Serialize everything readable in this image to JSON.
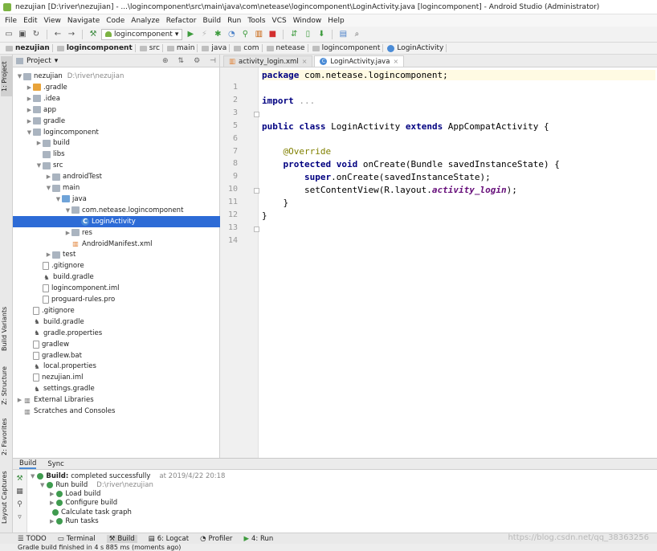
{
  "title": "nezujian [D:\\river\\nezujian] - ...\\logincomponent\\src\\main\\java\\com\\netease\\logincomponent\\LoginActivity.java [logincomponent] - Android Studio (Administrator)",
  "menu": [
    "File",
    "Edit",
    "View",
    "Navigate",
    "Code",
    "Analyze",
    "Refactor",
    "Build",
    "Run",
    "Tools",
    "VCS",
    "Window",
    "Help"
  ],
  "toolbar": {
    "run_config": "logincomponent",
    "icons": [
      "open-icon",
      "save-icon",
      "sync-icon",
      "back-icon",
      "forward-icon",
      "hammer-icon",
      "run-icon",
      "debug-icon",
      "bug-icon",
      "profile-icon",
      "apply-changes-icon",
      "stop-icon",
      "sdk-manager-icon",
      "avd-icon",
      "device-icon"
    ]
  },
  "breadcrumbs": [
    "nezujian",
    "logincomponent",
    "src",
    "main",
    "java",
    "com",
    "netease",
    "logincomponent",
    "LoginActivity"
  ],
  "left_strip": {
    "project": "1: Project",
    "build_variants": "Build Variants",
    "structure": "Z: Structure",
    "favorites": "2: Favorites",
    "layout_captures": "Layout Captures"
  },
  "project_panel": {
    "title": "Project",
    "tree": [
      {
        "label": "nezujian",
        "path": "D:\\river\\nezujian",
        "depth": 0,
        "arrow": "open",
        "icon": "folder"
      },
      {
        "label": ".gradle",
        "depth": 1,
        "arrow": "closed",
        "icon": "folder-orange"
      },
      {
        "label": ".idea",
        "depth": 1,
        "arrow": "closed",
        "icon": "folder"
      },
      {
        "label": "app",
        "depth": 1,
        "arrow": "closed",
        "icon": "folder"
      },
      {
        "label": "gradle",
        "depth": 1,
        "arrow": "closed",
        "icon": "folder"
      },
      {
        "label": "logincomponent",
        "depth": 1,
        "arrow": "open",
        "icon": "folder"
      },
      {
        "label": "build",
        "depth": 2,
        "arrow": "closed",
        "icon": "folder"
      },
      {
        "label": "libs",
        "depth": 2,
        "arrow": "",
        "icon": "folder"
      },
      {
        "label": "src",
        "depth": 2,
        "arrow": "open",
        "icon": "folder"
      },
      {
        "label": "androidTest",
        "depth": 3,
        "arrow": "closed",
        "icon": "folder"
      },
      {
        "label": "main",
        "depth": 3,
        "arrow": "open",
        "icon": "folder"
      },
      {
        "label": "java",
        "depth": 4,
        "arrow": "open",
        "icon": "folder-blue"
      },
      {
        "label": "com.netease.logincomponent",
        "depth": 5,
        "arrow": "open",
        "icon": "folder"
      },
      {
        "label": "LoginActivity",
        "depth": 6,
        "arrow": "",
        "icon": "class",
        "selected": true
      },
      {
        "label": "res",
        "depth": 5,
        "arrow": "closed",
        "icon": "folder"
      },
      {
        "label": "AndroidManifest.xml",
        "depth": 5,
        "arrow": "",
        "icon": "xml"
      },
      {
        "label": "test",
        "depth": 3,
        "arrow": "closed",
        "icon": "folder"
      },
      {
        "label": ".gitignore",
        "depth": 2,
        "arrow": "",
        "icon": "file"
      },
      {
        "label": "build.gradle",
        "depth": 2,
        "arrow": "",
        "icon": "gradle"
      },
      {
        "label": "logincomponent.iml",
        "depth": 2,
        "arrow": "",
        "icon": "file"
      },
      {
        "label": "proguard-rules.pro",
        "depth": 2,
        "arrow": "",
        "icon": "file"
      },
      {
        "label": ".gitignore",
        "depth": 1,
        "arrow": "",
        "icon": "file"
      },
      {
        "label": "build.gradle",
        "depth": 1,
        "arrow": "",
        "icon": "gradle"
      },
      {
        "label": "gradle.properties",
        "depth": 1,
        "arrow": "",
        "icon": "gradle"
      },
      {
        "label": "gradlew",
        "depth": 1,
        "arrow": "",
        "icon": "file"
      },
      {
        "label": "gradlew.bat",
        "depth": 1,
        "arrow": "",
        "icon": "file"
      },
      {
        "label": "local.properties",
        "depth": 1,
        "arrow": "",
        "icon": "gradle"
      },
      {
        "label": "nezujian.iml",
        "depth": 1,
        "arrow": "",
        "icon": "file"
      },
      {
        "label": "settings.gradle",
        "depth": 1,
        "arrow": "",
        "icon": "gradle"
      },
      {
        "label": "External Libraries",
        "depth": 0,
        "arrow": "closed",
        "icon": "lib"
      },
      {
        "label": "Scratches and Consoles",
        "depth": 0,
        "arrow": "",
        "icon": "lib"
      }
    ]
  },
  "editor": {
    "tabs": [
      {
        "label": "activity_login.xml",
        "active": false
      },
      {
        "label": "LoginActivity.java",
        "active": true
      }
    ],
    "lines": [
      {
        "no": "1",
        "html": "<span class=\"kw\">package</span> com.netease.logincomponent;",
        "current": true
      },
      {
        "no": "2",
        "html": ""
      },
      {
        "no": "3",
        "html": "<span class=\"kw\">import</span> <span class=\"fold\">...</span>"
      },
      {
        "no": "5",
        "html": ""
      },
      {
        "no": "6",
        "html": "<span class=\"kw\">public class</span> LoginActivity <span class=\"kw\">extends</span> AppCompatActivity {"
      },
      {
        "no": "7",
        "html": ""
      },
      {
        "no": "8",
        "html": "    <span class=\"ann\">@Override</span>"
      },
      {
        "no": "9",
        "html": "    <span class=\"kw\">protected void</span> onCreate(Bundle savedInstanceState) {"
      },
      {
        "no": "10",
        "html": "        <span class=\"kw\">super</span>.onCreate(savedInstanceState);"
      },
      {
        "no": "11",
        "html": "        setContentView(R.layout.<span class=\"it\">activity_login</span>);"
      },
      {
        "no": "12",
        "html": "    }"
      },
      {
        "no": "13",
        "html": "}"
      },
      {
        "no": "14",
        "html": ""
      }
    ]
  },
  "build_panel": {
    "tabs": [
      {
        "label": "Build",
        "active": true
      },
      {
        "label": "Sync",
        "active": false
      }
    ],
    "rows": [
      {
        "label": "Build:",
        "label2": "completed successfully",
        "meta": "at 2019/4/22 20:18",
        "depth": 0,
        "arrow": "open"
      },
      {
        "label": "Run build",
        "meta": "D:\\river\\nezujian",
        "depth": 1,
        "arrow": "open"
      },
      {
        "label": "Load build",
        "depth": 2,
        "arrow": "closed"
      },
      {
        "label": "Configure build",
        "depth": 2,
        "arrow": "closed"
      },
      {
        "label": "Calculate task graph",
        "depth": 2,
        "arrow": ""
      },
      {
        "label": "Run tasks",
        "depth": 2,
        "arrow": "closed"
      }
    ]
  },
  "bottom_tabs": [
    {
      "label": "TODO",
      "icon": "list-icon",
      "active": false
    },
    {
      "label": "Terminal",
      "icon": "terminal-icon",
      "active": false
    },
    {
      "label": "Build",
      "icon": "hammer-icon",
      "active": true
    },
    {
      "label": "6: Logcat",
      "icon": "logcat-icon",
      "active": false
    },
    {
      "label": "Profiler",
      "icon": "profiler-icon",
      "active": false
    },
    {
      "label": "4: Run",
      "icon": "run-icon",
      "active": false
    }
  ],
  "watermark": "https://blog.csdn.net/qq_38363256",
  "status": "Gradle build finished in 4 s 885 ms (moments ago)"
}
